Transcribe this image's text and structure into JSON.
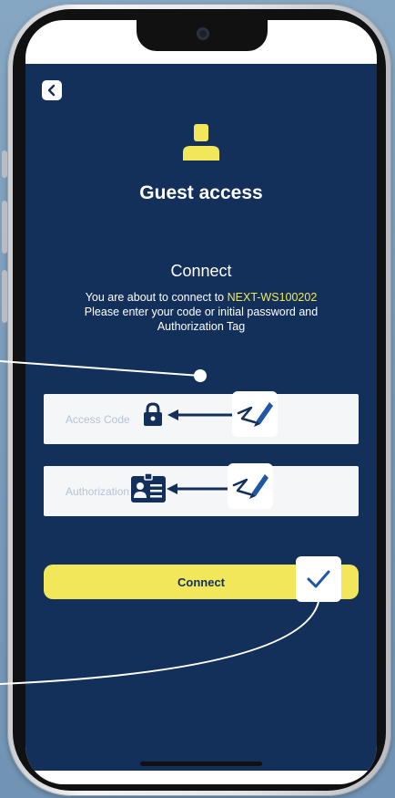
{
  "header": {
    "back_icon": "chevron-left-icon",
    "user_icon": "user-icon"
  },
  "title": "Guest access",
  "subtitle": "Connect",
  "description": {
    "line1_prefix": "You are about to connect to ",
    "device": "NEXT-WS100202",
    "line2": "Please enter your code or initial password and",
    "line3": "Authorization Tag"
  },
  "fields": {
    "access_code_placeholder": "Access Code",
    "authorization_placeholder": "Authorization"
  },
  "buttons": {
    "connect": "Connect"
  },
  "colors": {
    "app_bg": "#13305b",
    "accent": "#f2e65a",
    "highlight": "#f2e857"
  }
}
